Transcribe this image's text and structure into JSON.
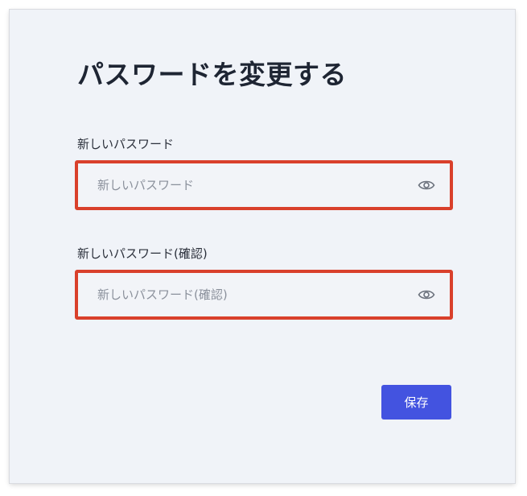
{
  "page": {
    "title": "パスワードを変更する"
  },
  "form": {
    "new_password": {
      "label": "新しいパスワード",
      "placeholder": "新しいパスワード",
      "value": "",
      "toggle_icon": "eye-icon"
    },
    "confirm_password": {
      "label": "新しいパスワード(確認)",
      "placeholder": "新しいパスワード(確認)",
      "value": "",
      "toggle_icon": "eye-icon"
    },
    "save_label": "保存"
  },
  "colors": {
    "primary_button": "#4353e0",
    "highlight_border": "#d9402b",
    "panel_background": "#f0f3f8"
  }
}
